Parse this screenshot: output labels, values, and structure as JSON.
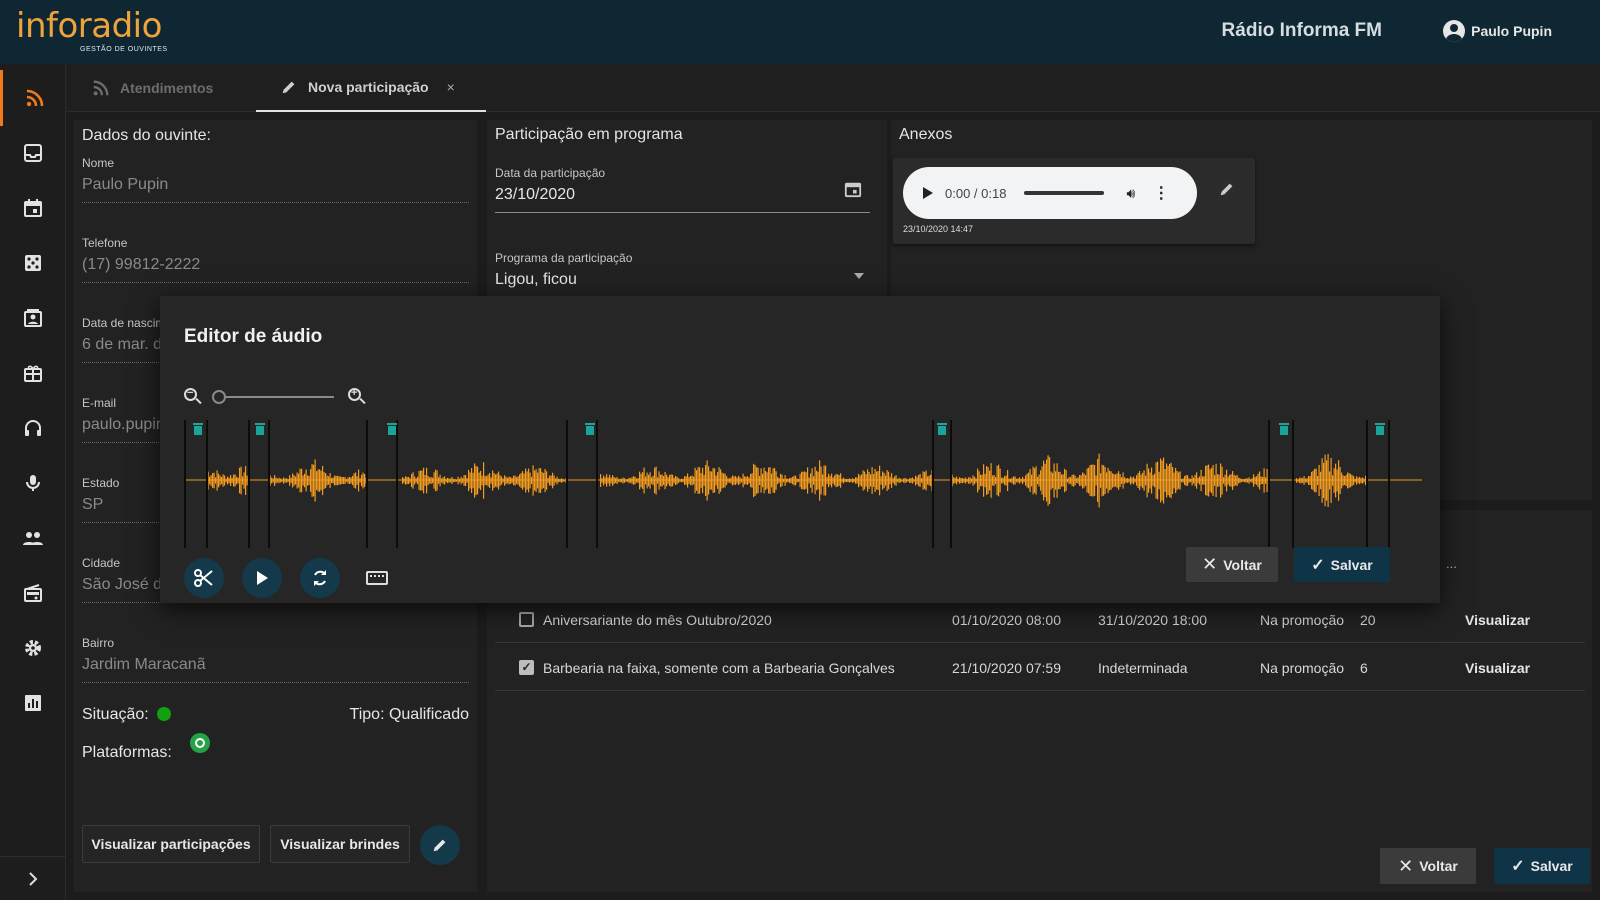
{
  "header": {
    "logo_text": "inforadio",
    "logo_subtitle": "GESTÃO DE OUVINTES",
    "station": "Rádio Informa FM",
    "user_name": "Paulo Pupin"
  },
  "sidebar": {
    "items": [
      {
        "icon": "rss-icon",
        "active": true
      },
      {
        "icon": "inbox-icon"
      },
      {
        "icon": "calendar-icon"
      },
      {
        "icon": "dice-icon"
      },
      {
        "icon": "contact-card-icon"
      },
      {
        "icon": "gift-icon"
      },
      {
        "icon": "headphones-icon"
      },
      {
        "icon": "microphone-icon"
      },
      {
        "icon": "people-icon"
      },
      {
        "icon": "radio-icon"
      },
      {
        "icon": "gear-icon"
      },
      {
        "icon": "bar-chart-icon"
      }
    ],
    "expand_icon": "chevron-right-icon"
  },
  "tabs": {
    "atendimentos": "Atendimentos",
    "nova_participacao": "Nova participação",
    "close": "×"
  },
  "listener": {
    "title": "Dados do ouvinte:",
    "nome_label": "Nome",
    "nome": "Paulo Pupin",
    "telefone_label": "Telefone",
    "telefone": "(17) 99812-2222",
    "nascimento_label": "Data de nascim",
    "nascimento": "6 de mar. d",
    "email_label": "E-mail",
    "email": "paulo.pupin",
    "estado_label": "Estado",
    "estado": "SP",
    "cidade_label": "Cidade",
    "cidade": "São José do Rio Preto",
    "bairro_label": "Bairro",
    "bairro": "Jardim Maracanã",
    "situacao_label": "Situação:",
    "tipo": "Tipo: Qualificado",
    "plataformas_label": "Plataformas:",
    "btn_participacoes": "Visualizar participações",
    "btn_brindes": "Visualizar brindes"
  },
  "participation": {
    "title": "Participação em programa",
    "data_label": "Data da participação",
    "data": "23/10/2020",
    "programa_label": "Programa da participação",
    "programa": "Ligou, ficou"
  },
  "anexos": {
    "title": "Anexos",
    "player_time": "0:00 / 0:18",
    "audio_date": "23/10/2020 14:47"
  },
  "promotions": {
    "more": "...",
    "rows": [
      {
        "checked": false,
        "name": "Aniversariante do mês Outubro/2020",
        "start": "01/10/2020 08:00",
        "end": "31/10/2020 18:00",
        "status": "Na promoção",
        "count": "20",
        "action": "Visualizar"
      },
      {
        "checked": true,
        "name": "Barbearia na faixa, somente com a Barbearia Gonçalves",
        "start": "21/10/2020 07:59",
        "end": "Indeterminada",
        "status": "Na promoção",
        "count": "6",
        "action": "Visualizar"
      }
    ]
  },
  "footer": {
    "voltar": "Voltar",
    "salvar": "Salvar"
  },
  "editor": {
    "title": "Editor de áudio",
    "zoom_level": 0,
    "audio_duration_s": 18,
    "voltar": "Voltar",
    "salvar": "Salvar",
    "waveform_color": "#f39c1f",
    "marker_color": "#1aa59a"
  }
}
